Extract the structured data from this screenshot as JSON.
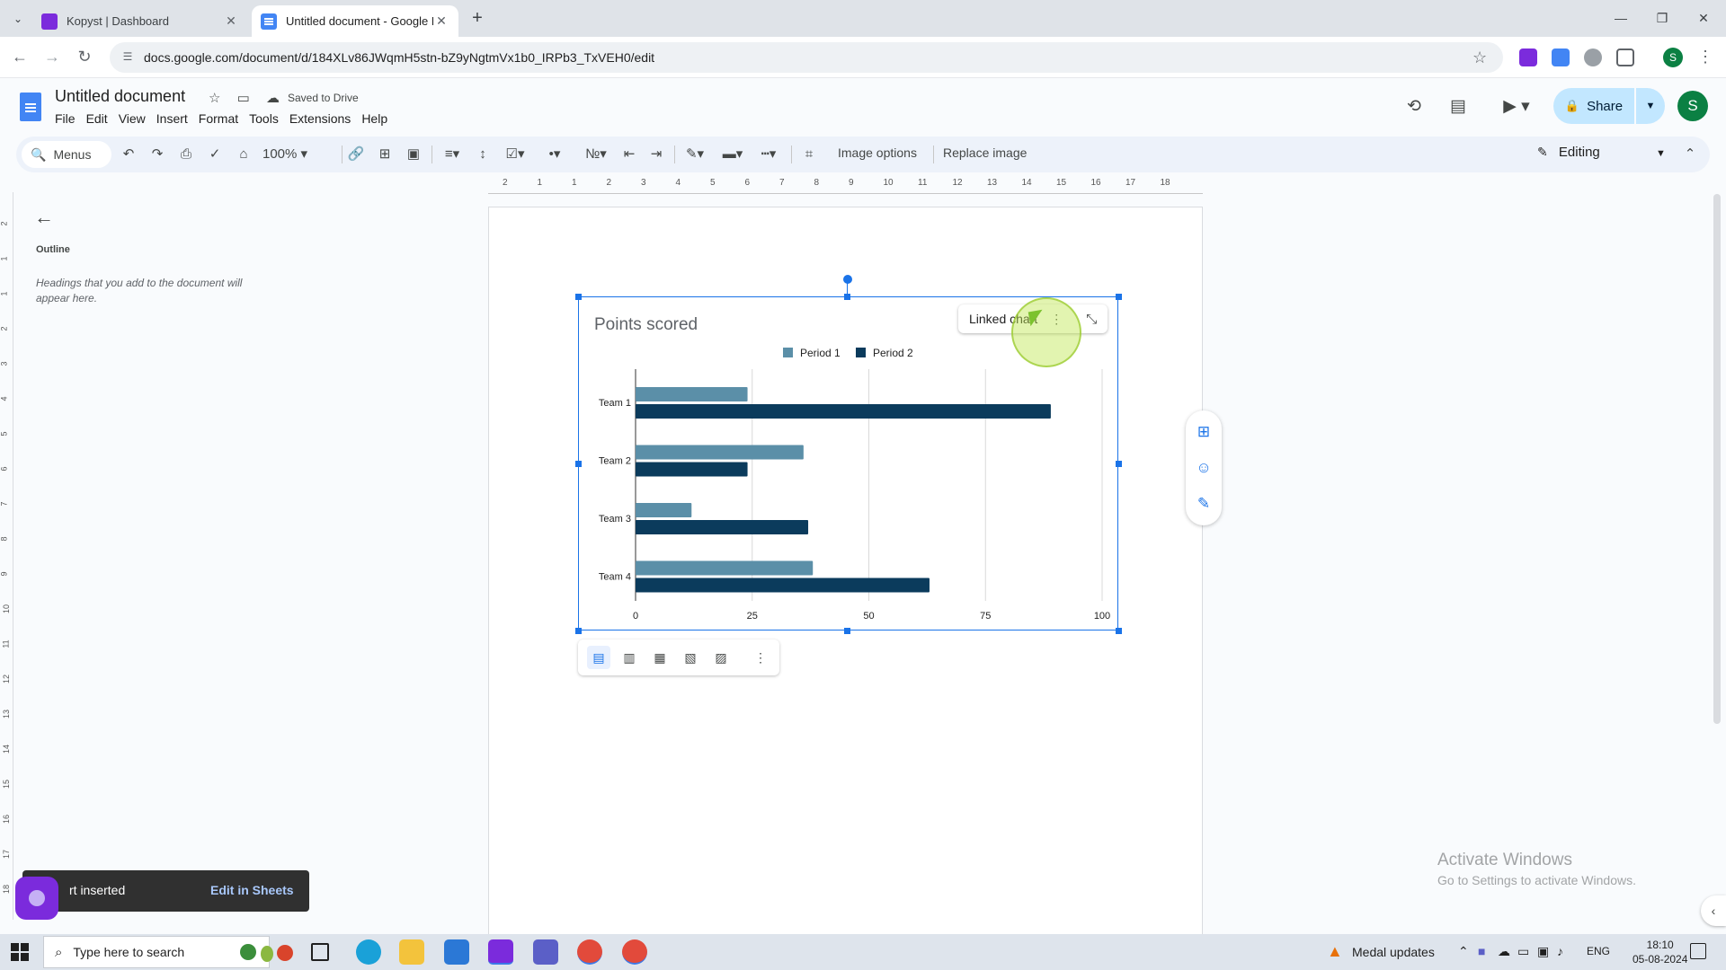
{
  "browser": {
    "tabs": [
      {
        "title": "Kopyst | Dashboard",
        "close": "✕"
      },
      {
        "title": "Untitled document - Google Docs",
        "close": "✕"
      }
    ],
    "new_tab": "+",
    "url": "docs.google.com/document/d/184XLv86JWqmH5stn-bZ9yNgtmVx1b0_IRPb3_TxVEH0/edit",
    "profile_initial": "S"
  },
  "docs": {
    "title": "Untitled document",
    "saved_status": "Saved to Drive",
    "menu": [
      "File",
      "Edit",
      "View",
      "Insert",
      "Format",
      "Tools",
      "Extensions",
      "Help"
    ],
    "share_label": "Share",
    "account_initial": "S"
  },
  "toolbar": {
    "search_label": "Menus",
    "zoom": "100%",
    "image_options": "Image options",
    "replace_image": "Replace image",
    "mode": "Editing"
  },
  "ruler": {
    "h_labels": [
      "2",
      "1",
      "1",
      "2",
      "3",
      "4",
      "5",
      "6",
      "7",
      "8",
      "9",
      "10",
      "11",
      "12",
      "13",
      "14",
      "15",
      "16",
      "17",
      "18"
    ],
    "v_labels": [
      "2",
      "1",
      "1",
      "2",
      "3",
      "4",
      "5",
      "6",
      "7",
      "8",
      "9",
      "10",
      "11",
      "12",
      "13",
      "14",
      "15",
      "16",
      "17",
      "18"
    ]
  },
  "outline": {
    "title": "Outline",
    "hint": "Headings that you add to the document will appear here."
  },
  "chart_data": {
    "type": "bar",
    "orientation": "horizontal",
    "title": "Points scored",
    "categories": [
      "Team 1",
      "Team 2",
      "Team 3",
      "Team 4"
    ],
    "series": [
      {
        "name": "Period 1",
        "values": [
          24,
          36,
          12,
          38
        ],
        "color": "#5b8fa8"
      },
      {
        "name": "Period 2",
        "values": [
          89,
          24,
          37,
          63
        ],
        "color": "#0b3b5c"
      }
    ],
    "xlim": [
      0,
      100
    ],
    "xticks": [
      "0",
      "25",
      "50",
      "75",
      "100"
    ],
    "legend": "top",
    "grid": true
  },
  "chart_chip": {
    "label": "Linked chart"
  },
  "snackbar": {
    "message": "rt inserted",
    "action": "Edit in Sheets"
  },
  "watermark": {
    "line1": "Activate Windows",
    "line2": "Go to Settings to activate Windows."
  },
  "taskbar": {
    "search_placeholder": "Type here to search",
    "notification": "Medal updates",
    "lang": "ENG",
    "time": "18:10",
    "date": "05-08-2024"
  }
}
